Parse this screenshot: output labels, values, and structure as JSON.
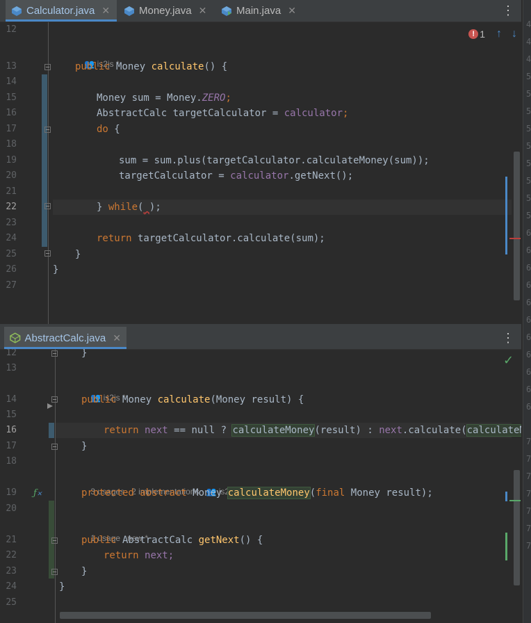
{
  "top_tabs": [
    {
      "label": "Calculator.java",
      "active": true
    },
    {
      "label": "Money.java",
      "active": false
    },
    {
      "label": "Main.java",
      "active": false
    }
  ],
  "bottom_tabs": [
    {
      "label": "AbstractCalc.java",
      "active": true
    }
  ],
  "inspection": {
    "error_count": "1"
  },
  "top_editor": {
    "hint_author": "is2js *",
    "line_numbers": [
      "12",
      "13",
      "14",
      "15",
      "16",
      "17",
      "18",
      "19",
      "20",
      "21",
      "22",
      "23",
      "24",
      "25",
      "26",
      "27"
    ],
    "current_line": "22",
    "tokens": {
      "public": "public",
      "money": "Money",
      "calculate": "calculate",
      "paren_open": "() {",
      "sum_decl": "Money sum = Money.",
      "zero": "ZERO",
      "semi": ";",
      "abs_decl": "AbstractCalc targetCalculator = ",
      "calculator": "calculator",
      "do": "do",
      "brace_open": " {",
      "sum_plus": "sum = sum.plus(targetCalculator.calculateMoney(sum));",
      "target_assign": "targetCalculator = ",
      "get_next": ".getNext();",
      "close_brace": "} ",
      "while": "while",
      "while_args": "(",
      "empty_arg": "_",
      "while_end": ");",
      "return": "return",
      "return_rest": " targetCalculator.calculate(sum);",
      "brace": "}"
    }
  },
  "bottom_editor": {
    "line_numbers": [
      "12",
      "13",
      "14",
      "15",
      "16",
      "17",
      "18",
      "19",
      "20",
      "21",
      "22",
      "23",
      "24",
      "25"
    ],
    "current_line": "16",
    "hint_author1": "is2js *",
    "hint_usages": "3 usages",
    "hint_impls": "2 implementations",
    "hint_author2": "is2js",
    "hint_usage1": "1 usage",
    "hint_new": "new *",
    "tokens": {
      "public": "public",
      "money": "Money",
      "calculate": "calculate",
      "params": "(Money result) {",
      "return": "return",
      "next": "next",
      "eq_null": " == null ? ",
      "calc_money": "calculateMoney",
      "result_colon": "(result) : ",
      "dot_calc": ".calculate(",
      "calc_money2": "calculateMone",
      "protected": "protected",
      "abstract": "abstract",
      "money2": " Money ",
      "final": "final",
      "money_result": " Money result);",
      "paren": "(",
      "abs_calc": " AbstractCalc ",
      "get_next": "getNext",
      "paren_brace": "() {",
      "next_semi": "next;",
      "brace": "}"
    }
  },
  "side_numbers": [
    "4",
    "4",
    "4",
    "5",
    "5",
    "5",
    "5",
    "5",
    "5",
    "5",
    "5",
    "5",
    "6",
    "6",
    "6",
    "6",
    "6",
    "6",
    "6",
    "6",
    "6",
    "6",
    "6",
    "7",
    "7",
    "7",
    "7",
    "7",
    "7",
    "7"
  ],
  "colors": {
    "keyword": "#cc7832",
    "function": "#ffc66d",
    "field": "#9876aa",
    "text": "#a9b7c6",
    "accent": "#4a88c7"
  }
}
